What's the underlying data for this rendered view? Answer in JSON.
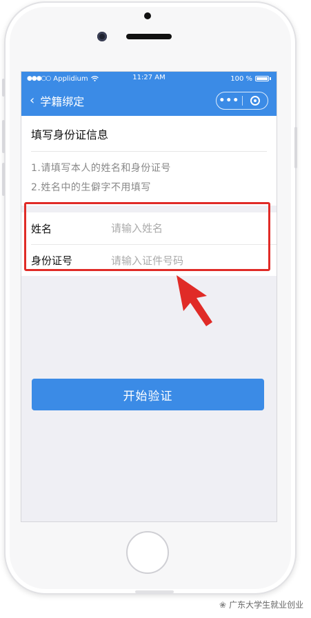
{
  "status_bar": {
    "signal": "●●●○○",
    "carrier": "Applidium",
    "wifi_icon": "wifi-icon",
    "time": "11:27 AM",
    "battery": "100 %"
  },
  "nav": {
    "back_icon": "‹",
    "title": "学籍绑定",
    "more": "•••"
  },
  "info": {
    "title": "填写身份证信息",
    "tips": [
      "1.请填写本人的姓名和身份证号",
      "2.姓名中的生僻字不用填写"
    ]
  },
  "form": {
    "name_label": "姓名",
    "name_placeholder": "请输入姓名",
    "id_label": "身份证号",
    "id_placeholder": "请输入证件号码"
  },
  "submit_label": "开始验证",
  "watermark": "广东大学生就业创业",
  "colors": {
    "brand_blue": "#3b8be6",
    "annotation_red": "#e02b27"
  }
}
